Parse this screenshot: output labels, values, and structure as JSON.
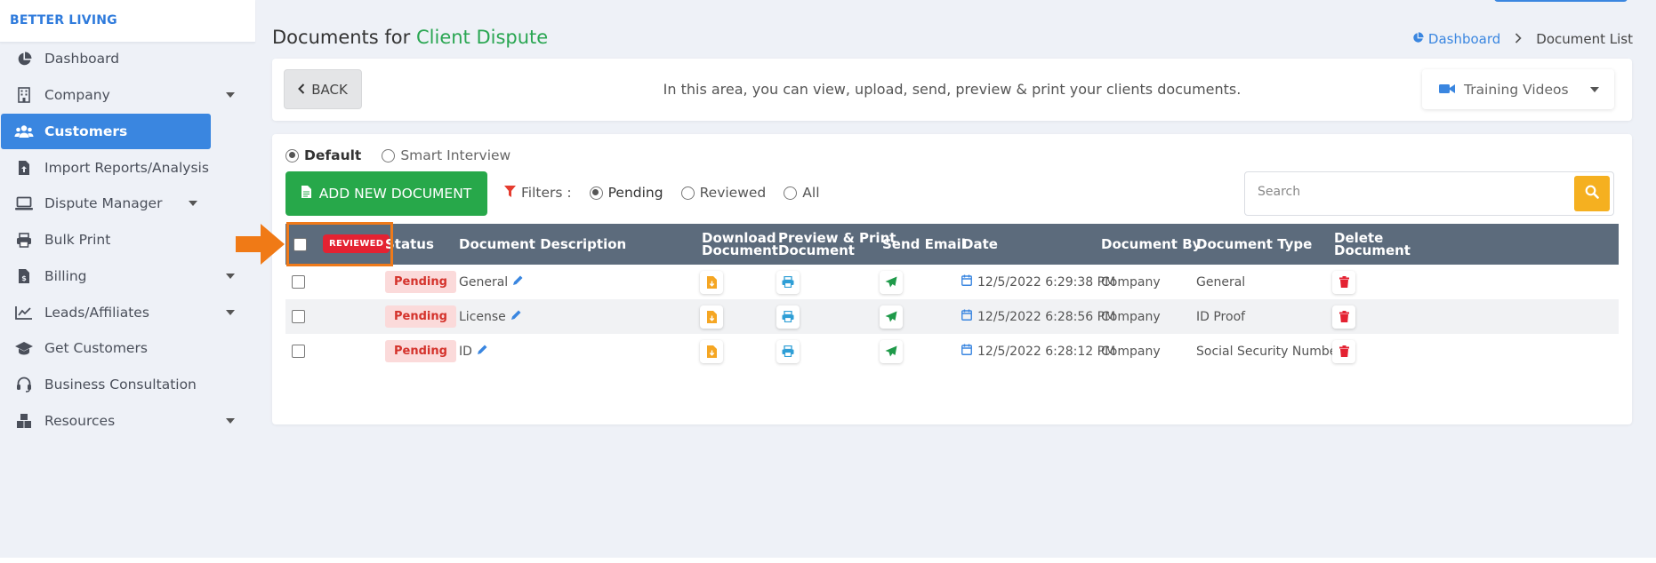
{
  "brand": "BETTER LIVING",
  "sidebar": {
    "items": [
      {
        "label": "Dashboard",
        "icon": "pie-chart-icon"
      },
      {
        "label": "Company",
        "icon": "building-icon",
        "has_caret": true
      },
      {
        "label": "Customers",
        "icon": "users-icon",
        "active": true
      },
      {
        "label": "Import Reports/Analysis",
        "icon": "file-upload-icon"
      },
      {
        "label": "Dispute Manager",
        "icon": "laptop-icon",
        "has_caret": true
      },
      {
        "label": "Bulk Print",
        "icon": "printer-icon"
      },
      {
        "label": "Billing",
        "icon": "invoice-icon",
        "has_caret": true
      },
      {
        "label": "Leads/Affiliates",
        "icon": "line-chart-icon",
        "has_caret": true
      },
      {
        "label": "Get Customers",
        "icon": "graduation-cap-icon"
      },
      {
        "label": "Business Consultation",
        "icon": "headset-icon"
      },
      {
        "label": "Resources",
        "icon": "boxes-icon",
        "has_caret": true
      }
    ]
  },
  "header": {
    "title_prefix": "Documents for",
    "title_highlight": "Client Dispute",
    "breadcrumb": {
      "home": "Dashboard",
      "current": "Document List"
    }
  },
  "info_bar": {
    "back_label": "BACK",
    "text": "In this area, you can view, upload, send, preview & print your clients documents.",
    "training_label": "Training Videos"
  },
  "modes": {
    "default": "Default",
    "smart": "Smart Interview",
    "selected": "Default"
  },
  "add_button": "ADD NEW DOCUMENT",
  "filters": {
    "label": "Filters :",
    "options": [
      "Pending",
      "Reviewed",
      "All"
    ],
    "selected": "Pending"
  },
  "search": {
    "placeholder": "Search"
  },
  "table": {
    "reviewed_badge": "REVIEWED",
    "headers": {
      "status": "Status",
      "description": "Document Description",
      "download": [
        "Download",
        "Document"
      ],
      "preview": [
        "Preview & Print",
        "Document"
      ],
      "email": "Send Email",
      "date": "Date",
      "by": "Document By",
      "type": "Document Type",
      "delete": [
        "Delete",
        "Document"
      ]
    },
    "rows": [
      {
        "status": "Pending",
        "description": "General",
        "date": "12/5/2022 6:29:38 PM",
        "by": "Company",
        "type": "General"
      },
      {
        "status": "Pending",
        "description": "License",
        "date": "12/5/2022 6:28:56 PM",
        "by": "Company",
        "type": "ID Proof"
      },
      {
        "status": "Pending",
        "description": "ID",
        "date": "12/5/2022 6:28:12 PM",
        "by": "Company",
        "type": "Social Security Number"
      }
    ]
  },
  "colors": {
    "accent_blue": "#3a86e0",
    "green": "#27a84a",
    "header_row": "#5c6b7c",
    "pending_bg": "#fbdada",
    "pending_text": "#d4322b",
    "reviewed_red": "#e42232",
    "highlight_orange": "#ef7a1a",
    "search_yellow": "#f5b020"
  }
}
